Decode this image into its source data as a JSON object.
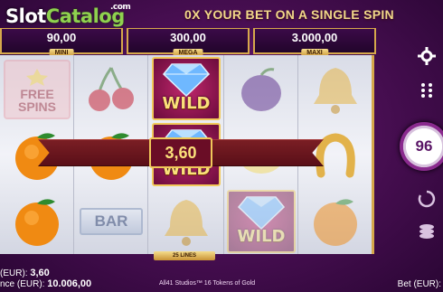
{
  "logo": {
    "slot": "Slot",
    "catalog": "Catalog",
    "com": ".com"
  },
  "headline": "0X YOUR BET ON A SINGLE SPIN",
  "jackpots": {
    "mini": {
      "value": "90,00",
      "label": "MINI"
    },
    "mega": {
      "value": "300,00",
      "label": "MEGA"
    },
    "maxi": {
      "value": "3.000,00",
      "label": "MAXI"
    }
  },
  "reels": {
    "wild_text": "WILD",
    "free_spins": [
      "FREE",
      "SPINS"
    ],
    "bar_text": "BAR",
    "win_amount": "3,60",
    "lines": "25 LINES"
  },
  "controls": {
    "spin_counter": "96",
    "icons": [
      "gear-icon",
      "menu-dots-icon",
      "spin-icon",
      "autoplay-icon",
      "coins-icon"
    ]
  },
  "footer": {
    "win_prefix": "(EUR):",
    "win_value": "3,60",
    "balance_prefix": "nce (EUR):",
    "balance_value": "10.006,00",
    "credits": "All41 Studios™ 16 Tokens of Gold",
    "bet_label": "Bet (EUR):"
  },
  "colors": {
    "gold": "#d6a84b",
    "purple_bg": "#4b0f55",
    "win_text": "#fbe07a",
    "logo_green": "#8fd14f"
  }
}
